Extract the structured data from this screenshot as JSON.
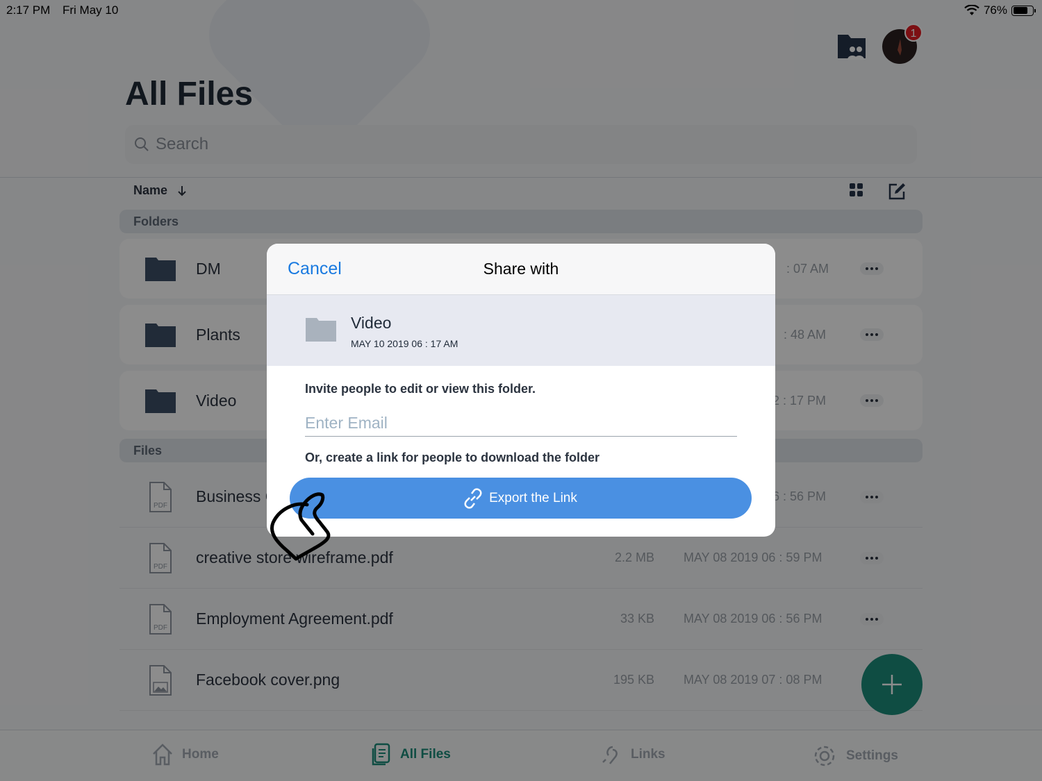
{
  "status_bar": {
    "time": "2:17 PM",
    "date": "Fri May 10",
    "battery": "76%"
  },
  "notifications": {
    "badge_count": "1"
  },
  "page": {
    "title": "All Files"
  },
  "search": {
    "placeholder": "Search"
  },
  "sort": {
    "label": "Name"
  },
  "sections": {
    "folders": "Folders",
    "files": "Files"
  },
  "folders": [
    {
      "name": "DM",
      "date": ": 07 AM"
    },
    {
      "name": "Plants",
      "date": ": 48 AM"
    },
    {
      "name": "Video",
      "date": "2 : 17 PM"
    }
  ],
  "files": [
    {
      "name": "Business Co",
      "size": "",
      "date": "6 : 56 PM",
      "type": "PDF"
    },
    {
      "name": "creative store wireframe.pdf",
      "size": "2.2 MB",
      "date": "MAY 08 2019 06 : 59 PM",
      "type": "PDF"
    },
    {
      "name": "Employment Agreement.pdf",
      "size": "33 KB",
      "date": "MAY 08 2019 06 : 56 PM",
      "type": "PDF"
    },
    {
      "name": "Facebook cover.png",
      "size": "195 KB",
      "date": "MAY 08 2019 07 : 08 PM",
      "type": "image"
    }
  ],
  "tabs": [
    {
      "label": "Home",
      "icon": "home-icon"
    },
    {
      "label": "All Files",
      "icon": "files-icon",
      "active": true
    },
    {
      "label": "Links",
      "icon": "link-icon"
    },
    {
      "label": "Settings",
      "icon": "gear-icon"
    }
  ],
  "modal": {
    "cancel": "Cancel",
    "title": "Share with",
    "folder_name": "Video",
    "folder_date": "MAY 10 2019 06 : 17 AM",
    "invite_text": "Invite people to edit or view this folder.",
    "email_placeholder": "Enter Email",
    "or_text": "Or, create a link for people to download the folder",
    "export_label": "Export the Link"
  },
  "colors": {
    "accent": "#1c8c7a",
    "link_blue": "#1a7ae0",
    "button_blue": "#4a90e2",
    "badge_red": "#e21d24"
  }
}
